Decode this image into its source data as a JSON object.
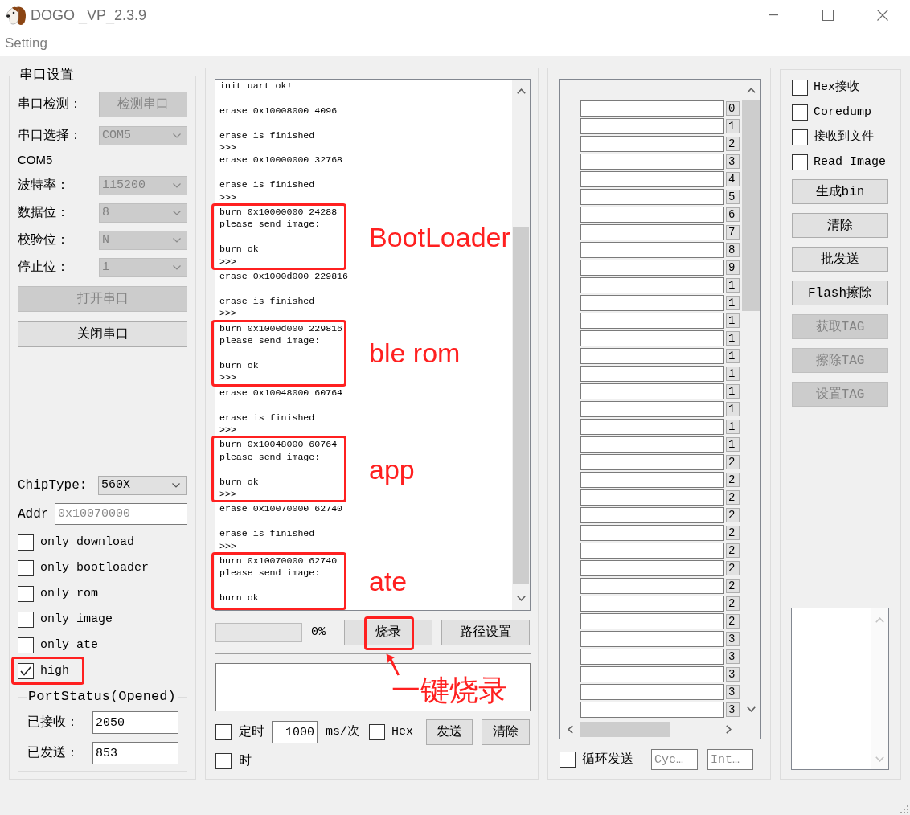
{
  "window": {
    "title": "DOGO _VP_2.3.9"
  },
  "menu": [
    {
      "label": "Setting"
    }
  ],
  "serial": {
    "title": "串口设置",
    "detect": {
      "label": "串口检测：",
      "button": "检测串口",
      "disabled": true
    },
    "port": {
      "label": "串口选择：",
      "value": "COM5",
      "disabled": true
    },
    "port_name": "COM5",
    "params": [
      {
        "label": "波特率：",
        "value": "115200",
        "disabled": true
      },
      {
        "label": "数据位：",
        "value": "8",
        "disabled": true
      },
      {
        "label": "校验位：",
        "value": "N",
        "disabled": true
      },
      {
        "label": "停止位：",
        "value": "1",
        "disabled": true
      }
    ],
    "buttons": [
      {
        "label": "打开串口",
        "disabled": true
      },
      {
        "label": "关闭串口",
        "disabled": false
      }
    ],
    "chip_type": {
      "label": "ChipType:",
      "value": "560X"
    },
    "addr": {
      "label": "Addr",
      "placeholder": "0x10070000"
    },
    "options": [
      {
        "label": "only download",
        "checked": false,
        "highlighted": false
      },
      {
        "label": "only bootloader",
        "checked": false,
        "highlighted": false
      },
      {
        "label": "only rom",
        "checked": false,
        "highlighted": false
      },
      {
        "label": "only image",
        "checked": false,
        "highlighted": false
      },
      {
        "label": "only ate",
        "checked": false,
        "highlighted": false
      },
      {
        "label": "high",
        "checked": true,
        "highlighted": true
      }
    ],
    "port_status": {
      "title": "PortStatus(Opened)",
      "rows": [
        {
          "label": "已接收：",
          "value": "2050"
        },
        {
          "label": "已发送：",
          "value": "853"
        }
      ]
    }
  },
  "log": {
    "blocks": [
      {
        "text": "init uart ok!\n\nerase 0x10008000 4096\n\nerase is finished\n>>>\nerase 0x10000000 32768\n\nerase is finished\n>>>"
      },
      {
        "text": "burn 0x10000000 24288\nplease send image:\n\nburn ok\n>>>",
        "annotation": "BootLoader"
      },
      {
        "text": "erase 0x1000d000 229816\n\nerase is finished\n>>>"
      },
      {
        "text": "burn 0x1000d000 229816\nplease send image:\n\nburn ok\n>>>",
        "annotation": "ble rom"
      },
      {
        "text": "erase 0x10048000 60764\n\nerase is finished\n>>>"
      },
      {
        "text": "burn 0x10048000 60764\nplease send image:\n\nburn ok\n>>>",
        "annotation": "app"
      },
      {
        "text": "erase 0x10070000 62740\n\nerase is finished\n>>>"
      },
      {
        "text": "burn 0x10070000 62740\nplease send image:\n\nburn ok",
        "annotation": "ate"
      }
    ]
  },
  "burn": {
    "progress": {
      "level": 0,
      "reading": "0%"
    },
    "buttons": [
      {
        "label": "烧录",
        "highlighted": true,
        "callout": "一键烧录"
      },
      {
        "label": "路径设置",
        "highlighted": false
      }
    ]
  },
  "send": {
    "timer": {
      "label": "定时",
      "checked": false,
      "value": "1000",
      "unit": "ms/次"
    },
    "hex": {
      "label": "Hex",
      "checked": false
    },
    "buttons": [
      {
        "label": "发送"
      },
      {
        "label": "清除"
      }
    ],
    "time": {
      "label": "时",
      "checked": false
    }
  },
  "send_list": {
    "rows": [
      {
        "button": "0"
      },
      {
        "button": "1"
      },
      {
        "button": "2"
      },
      {
        "button": "3"
      },
      {
        "button": "4"
      },
      {
        "button": "5"
      },
      {
        "button": "6"
      },
      {
        "button": "7"
      },
      {
        "button": "8"
      },
      {
        "button": "9"
      },
      {
        "button": "1"
      },
      {
        "button": "1"
      },
      {
        "button": "1"
      },
      {
        "button": "1"
      },
      {
        "button": "1"
      },
      {
        "button": "1"
      },
      {
        "button": "1"
      },
      {
        "button": "1"
      },
      {
        "button": "1"
      },
      {
        "button": "1"
      },
      {
        "button": "2"
      },
      {
        "button": "2"
      },
      {
        "button": "2"
      },
      {
        "button": "2"
      },
      {
        "button": "2"
      },
      {
        "button": "2"
      },
      {
        "button": "2"
      },
      {
        "button": "2"
      },
      {
        "button": "2"
      },
      {
        "button": "2"
      },
      {
        "button": "3"
      },
      {
        "button": "3"
      },
      {
        "button": "3"
      },
      {
        "button": "3"
      },
      {
        "button": "3"
      }
    ],
    "loop": {
      "label": "循环发送",
      "checked": false
    },
    "cycle": {
      "placeholder": "Cyc…"
    },
    "interval": {
      "placeholder": "Int…"
    }
  },
  "tools": {
    "options": [
      {
        "label": "Hex接收",
        "checked": false
      },
      {
        "label": "Coredump",
        "checked": false
      },
      {
        "label": "接收到文件",
        "checked": false
      },
      {
        "label": "Read Image",
        "checked": false
      }
    ],
    "buttons": [
      {
        "label": "生成bin",
        "disabled": false
      },
      {
        "label": "清除",
        "disabled": false
      },
      {
        "label": "批发送",
        "disabled": false
      }
    ],
    "flash_buttons": [
      {
        "label": "Flash擦除",
        "disabled": false
      },
      {
        "label": "获取TAG",
        "disabled": true
      },
      {
        "label": "擦除TAG",
        "disabled": true
      },
      {
        "label": "设置TAG",
        "disabled": true
      }
    ]
  }
}
